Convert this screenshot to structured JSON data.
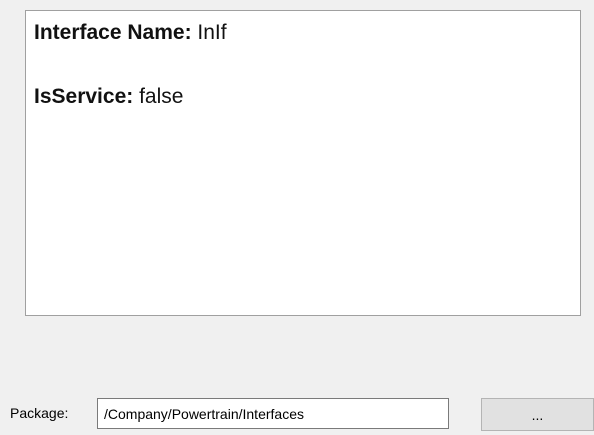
{
  "info_panel": {
    "rows": [
      {
        "key": "Interface Name:",
        "value": "InIf"
      },
      {
        "key": "IsService:",
        "value": "false"
      }
    ]
  },
  "package": {
    "label": "Package:",
    "value": "/Company/Powertrain/Interfaces"
  },
  "browse_button": {
    "label": "..."
  },
  "colors": {
    "background": "#f0f0f0",
    "panel": "#ffffff",
    "button": "#e1e1e1",
    "border": "#a0a0a0"
  }
}
